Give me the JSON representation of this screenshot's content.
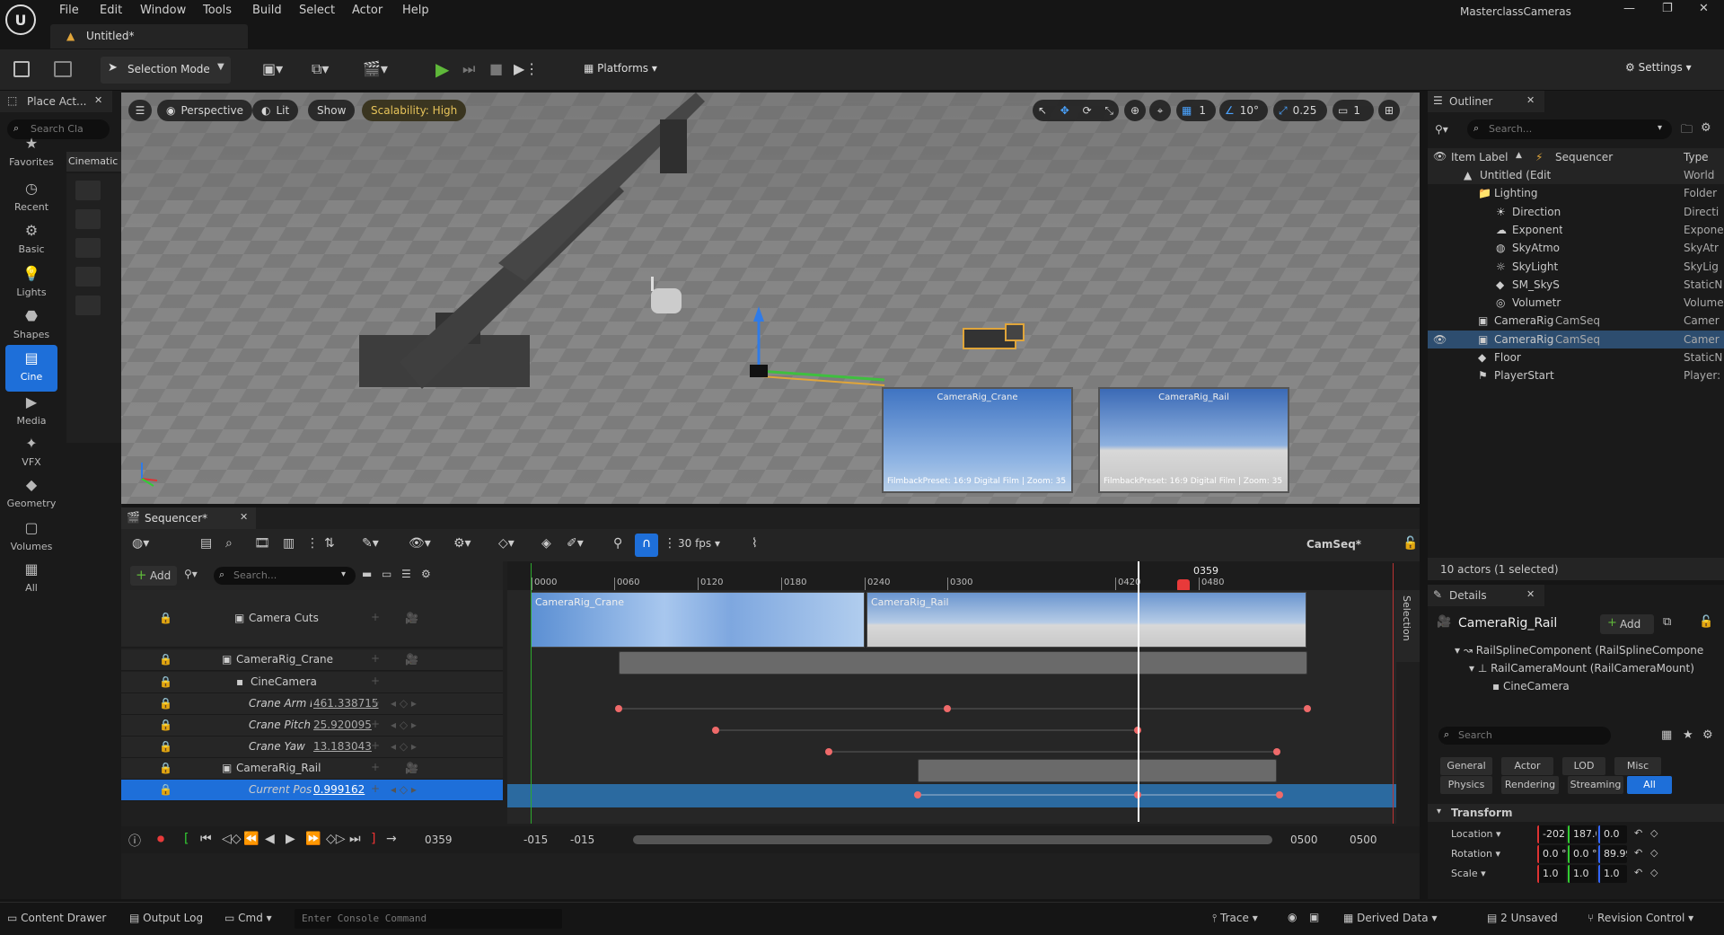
{
  "app": {
    "project_name": "MasterclassCameras",
    "level_tab": "Untitled*"
  },
  "menu": [
    "File",
    "Edit",
    "Window",
    "Tools",
    "Build",
    "Select",
    "Actor",
    "Help"
  ],
  "toolbar": {
    "selection_mode": "Selection Mode",
    "platforms": "Platforms",
    "settings": "Settings"
  },
  "place_actors": {
    "title": "Place Act...",
    "search_placeholder": "Search Cla",
    "active_tab": "Cinematic",
    "categories": [
      {
        "label": "Favorites",
        "icon": "star-icon"
      },
      {
        "label": "Recent",
        "icon": "clock-icon"
      },
      {
        "label": "Basic",
        "icon": "basic-shapes-icon"
      },
      {
        "label": "Lights",
        "icon": "lightbulb-icon"
      },
      {
        "label": "Shapes",
        "icon": "shapes-icon"
      },
      {
        "label": "Cine",
        "icon": "clapper-icon"
      },
      {
        "label": "Media",
        "icon": "media-icon"
      },
      {
        "label": "VFX",
        "icon": "vfx-icon"
      },
      {
        "label": "Geometry",
        "icon": "geometry-icon"
      },
      {
        "label": "Volumes",
        "icon": "volume-icon"
      },
      {
        "label": "All",
        "icon": "all-icon"
      }
    ]
  },
  "viewport": {
    "perspective": "Perspective",
    "lit": "Lit",
    "show": "Show",
    "scalability": "Scalability: High",
    "grid_snap": "1",
    "rotation_snap": "10°",
    "scale_snap": "0.25",
    "camera_speed": "1",
    "previews": [
      {
        "title": "CameraRig_Crane",
        "info": "FilmbackPreset: 16:9 Digital Film | Zoom: 35"
      },
      {
        "title": "CameraRig_Rail",
        "info": "FilmbackPreset: 16:9 Digital Film | Zoom: 35"
      }
    ]
  },
  "outliner": {
    "title": "Outliner",
    "search_placeholder": "Search...",
    "col_label": "Item Label",
    "col_seq": "Sequencer",
    "col_type": "Type",
    "rows": [
      {
        "label": "Untitled (Edit",
        "seq": "",
        "type": "World"
      },
      {
        "label": "Lighting",
        "seq": "",
        "type": "Folder"
      },
      {
        "label": "Direction",
        "seq": "",
        "type": "Directi"
      },
      {
        "label": "Exponent",
        "seq": "",
        "type": "Expone"
      },
      {
        "label": "SkyAtmo",
        "seq": "",
        "type": "SkyAtr"
      },
      {
        "label": "SkyLight",
        "seq": "",
        "type": "SkyLig"
      },
      {
        "label": "SM_SkyS",
        "seq": "",
        "type": "StaticN"
      },
      {
        "label": "Volumetr",
        "seq": "",
        "type": "Volume"
      },
      {
        "label": "CameraRig",
        "seq": "CamSeq",
        "type": "Camer"
      },
      {
        "label": "CameraRig",
        "seq": "CamSeq",
        "type": "Camer"
      },
      {
        "label": "Floor",
        "seq": "",
        "type": "StaticN"
      },
      {
        "label": "PlayerStart",
        "seq": "",
        "type": "Player:"
      }
    ],
    "status": "10 actors (1 selected)"
  },
  "details": {
    "title": "Details",
    "actor_name": "CameraRig_Rail",
    "add": "Add",
    "components": [
      "RailSplineComponent (RailSplineCompone",
      "RailCameraMount (RailCameraMount)",
      "CineCamera"
    ],
    "search_placeholder": "Search",
    "filters_row1": [
      "General",
      "Actor",
      "LOD",
      "Misc"
    ],
    "filters_row2": [
      "Physics",
      "Rendering",
      "Streaming",
      "All"
    ],
    "transform_label": "Transform",
    "location_label": "Location",
    "location": [
      "-202",
      "187.0",
      "0.0"
    ],
    "rotation_label": "Rotation",
    "rotation": [
      "0.0 °",
      "0.0 °",
      "89.99"
    ],
    "scale_label": "Scale",
    "scale": [
      "1.0",
      "1.0",
      "1.0"
    ]
  },
  "sequencer": {
    "tab": "Sequencer*",
    "add": "Add",
    "search_placeholder": "Search...",
    "fps": "30 fps",
    "seq_name": "CamSeq*",
    "ticks": [
      "0000",
      "0060",
      "0120",
      "0180",
      "0240",
      "0300",
      "0420",
      "0480"
    ],
    "playhead": "0359",
    "selection_label": "Selection",
    "tracks": [
      {
        "label": "Camera Cuts"
      },
      {
        "label": "CameraRig_Crane"
      },
      {
        "label": "CineCamera"
      },
      {
        "label": "Crane Arm Le",
        "value": "461.338715"
      },
      {
        "label": "Crane Pitch",
        "value": "25.920095"
      },
      {
        "label": "Crane Yaw",
        "value": "13.183043"
      },
      {
        "label": "CameraRig_Rail"
      },
      {
        "label": "Current Posit",
        "value": "0.999162"
      }
    ],
    "cut_labels": [
      "CameraRig_Crane",
      "CameraRig_Rail"
    ],
    "current_frame": "0359",
    "range_start": "-015",
    "range_start2": "-015",
    "range_end": "0500",
    "range_end2": "0500"
  },
  "statusbar": {
    "content_drawer": "Content Drawer",
    "output_log": "Output Log",
    "cmd": "Cmd",
    "console_placeholder": "Enter Console Command",
    "trace": "Trace",
    "derived_data": "Derived Data",
    "unsaved": "2 Unsaved",
    "revision_control": "Revision Control"
  }
}
